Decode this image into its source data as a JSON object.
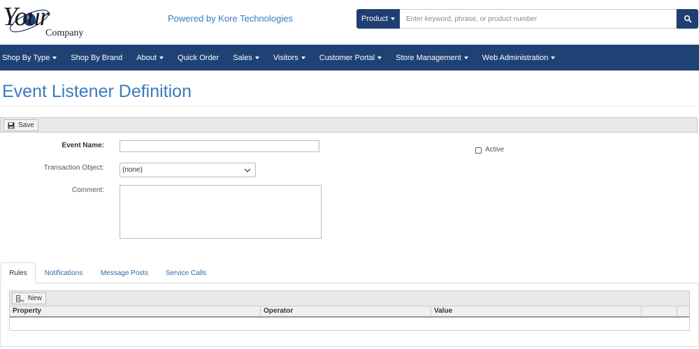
{
  "header": {
    "logo_your": "Your",
    "logo_company": "Company",
    "powered_by": "Powered by Kore Technologies",
    "product_label": "Product",
    "search_placeholder": "Enter keyword, phrase, or product number",
    "search_icon": "search-icon"
  },
  "nav": {
    "items": [
      {
        "label": "Shop By Type",
        "dropdown": true
      },
      {
        "label": "Shop By Brand",
        "dropdown": false
      },
      {
        "label": "About",
        "dropdown": true
      },
      {
        "label": "Quick Order",
        "dropdown": false
      },
      {
        "label": "Sales",
        "dropdown": true
      },
      {
        "label": "Visitors",
        "dropdown": true
      },
      {
        "label": "Customer Portal",
        "dropdown": true
      },
      {
        "label": "Store Management",
        "dropdown": true
      },
      {
        "label": "Web Administration",
        "dropdown": true
      }
    ]
  },
  "page": {
    "title": "Event Listener Definition"
  },
  "toolbar": {
    "save_label": "Save",
    "save_icon": "floppy-disk-icon"
  },
  "form": {
    "event_name_label": "Event Name:",
    "event_name_value": "",
    "transaction_object_label": "Transaction Object:",
    "transaction_object_value": "(none)",
    "comment_label": "Comment:",
    "comment_value": "",
    "active_label": "Active",
    "active_checked": false
  },
  "tabs": {
    "items": [
      {
        "label": "Rules",
        "active": true
      },
      {
        "label": "Notifications",
        "active": false
      },
      {
        "label": "Message Posts",
        "active": false
      },
      {
        "label": "Service Calls",
        "active": false
      }
    ]
  },
  "grid": {
    "new_label": "New",
    "new_icon": "new-rule-icon",
    "columns": [
      "Property",
      "Operator",
      "Value",
      "",
      ""
    ]
  },
  "colors": {
    "nav_bg": "#1f4275",
    "accent_dark": "#1f3f73",
    "title_blue": "#3b7bbf",
    "tab_link": "#2f6aa8"
  }
}
